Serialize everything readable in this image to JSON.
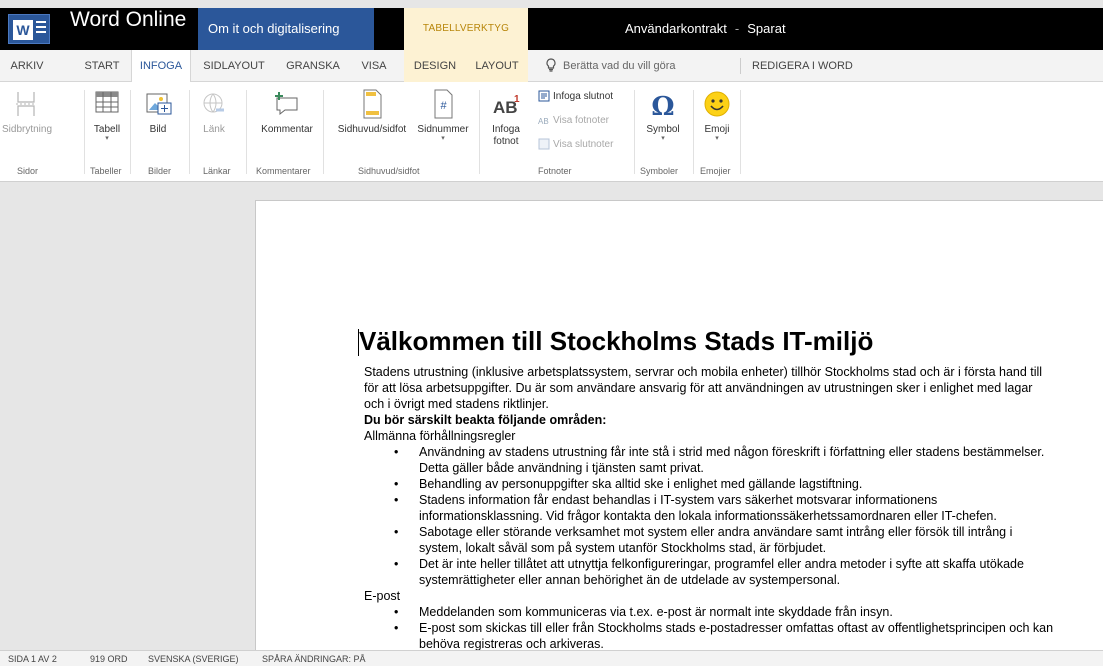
{
  "app": {
    "name": "Word Online",
    "breadcrumb": "Om it och digitalisering",
    "context_header": "TABELLVERKTYG",
    "doc_name": "Användarkontrakt",
    "separator": "-",
    "save_state": "Sparat"
  },
  "tabs": [
    {
      "label": "ARKIV"
    },
    {
      "label": "START"
    },
    {
      "label": "INFOGA"
    },
    {
      "label": "SIDLAYOUT"
    },
    {
      "label": "GRANSKA"
    },
    {
      "label": "VISA"
    },
    {
      "label": "DESIGN"
    },
    {
      "label": "LAYOUT"
    }
  ],
  "tellme": {
    "placeholder": "Berätta vad du vill göra"
  },
  "edit_in_word": "REDIGERA I WORD",
  "ribbon": {
    "page_break": "Sidbrytning",
    "table": "Tabell",
    "picture": "Bild",
    "link": "Länk",
    "comment": "Kommentar",
    "header_footer": "Sidhuvud/sidfot",
    "page_number": "Sidnummer",
    "footnote": "Infoga fotnot",
    "insert_endnote": "Infoga slutnot",
    "show_footnotes": "Visa fotnoter",
    "show_endnotes": "Visa slutnoter",
    "symbol": "Symbol",
    "emoji": "Emoji",
    "groups": {
      "pages": "Sidor",
      "tables": "Tabeller",
      "pictures": "Bilder",
      "links": "Länkar",
      "comments": "Kommentarer",
      "header_footer": "Sidhuvud/sidfot",
      "footnotes": "Fotnoter",
      "symbols": "Symboler",
      "emojis": "Emojier"
    }
  },
  "document": {
    "heading": "Välkommen till Stockholms Stads IT-miljö",
    "intro": "Stadens utrustning (inklusive arbetsplatssystem, servrar och mobila enheter) tillhör Stockholms stad och är i första hand till för att lösa arbetsuppgifter. Du är som användare ansvarig för att användningen av utrustningen sker i enlighet med lagar och i övrigt med stadens riktlinjer.",
    "emphasis": "Du bör särskilt beakta följande områden:",
    "section1": "Allmänna förhållningsregler",
    "bullets1": [
      "Användning av stadens utrustning får inte stå i strid med någon föreskrift i författning eller stadens bestämmelser. Detta gäller både användning i tjänsten samt privat.",
      "Behandling av personuppgifter ska alltid ske i enlighet med gällande lagstiftning.",
      "Stadens information får endast behandlas i IT-system vars säkerhet motsvarar informationens informationsklassning. Vid frågor kontakta den lokala informationssäkerhetssamordnaren eller IT-chefen.",
      "Sabotage eller störande verksamhet mot system eller andra användare samt intrång eller försök till intrång i system, lokalt såväl som på system utanför Stockholms stad, är förbjudet.",
      "Det är inte heller tillåtet att utnyttja felkonfigureringar, programfel eller andra metoder i syfte att skaffa utökade systemrättigheter eller annan behörighet än de utdelade av systempersonal."
    ],
    "section2": "E-post",
    "bullets2": [
      "Meddelanden som kommuniceras via t.ex. e-post är normalt inte skyddade från insyn.",
      "E-post som skickas till eller från Stockholms stads e-postadresser omfattas oftast av offentlighetsprincipen och kan behöva registreras och arkiveras."
    ]
  },
  "status": {
    "page": "SIDA 1 AV 2",
    "words": "919 ORD",
    "language": "SVENSKA (SVERIGE)",
    "track_changes": "SPÅRA ÄNDRINGAR: PÅ"
  },
  "colors": {
    "brand": "#2b579a",
    "context": "#fdf2d3",
    "titlebar": "#000000"
  }
}
